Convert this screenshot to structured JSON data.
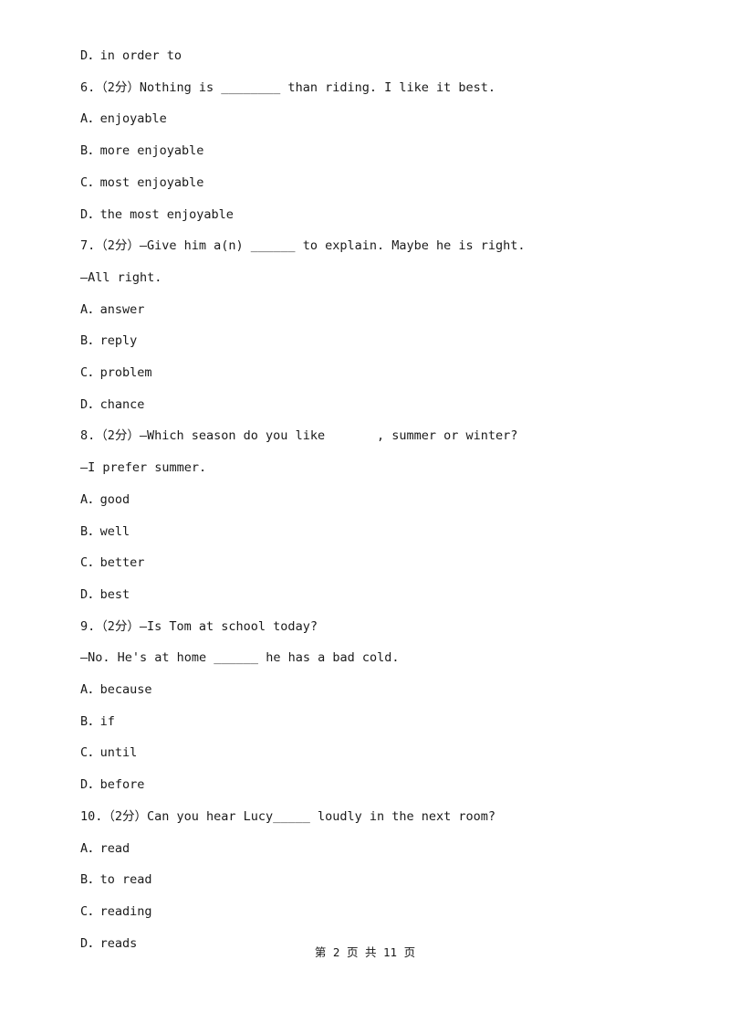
{
  "document": {
    "lines": [
      "D．in order to",
      "6.（2分）Nothing is ________ than riding. I like it best.",
      "A．enjoyable",
      "B．more enjoyable",
      "C．most enjoyable",
      "D．the most enjoyable",
      "7.（2分）—Give him a(n) ______ to explain. Maybe he is right.",
      "—All right.",
      "A．answer",
      "B．reply",
      "C．problem",
      "D．chance",
      "8.（2分）—Which season do you like       , summer or winter?",
      "—I prefer summer.",
      "A．good",
      "B．well",
      "C．better",
      "D．best",
      "9.（2分）—Is Tom at school today?",
      "—No. He's at home ______ he has a bad cold.",
      "A．because",
      "B．if",
      "C．until",
      "D．before",
      "10.（2分）Can you hear Lucy_____ loudly in the next room?",
      "A．read",
      "B．to read",
      "C．reading",
      "D．reads"
    ],
    "footer": "第 2 页 共 11 页"
  }
}
